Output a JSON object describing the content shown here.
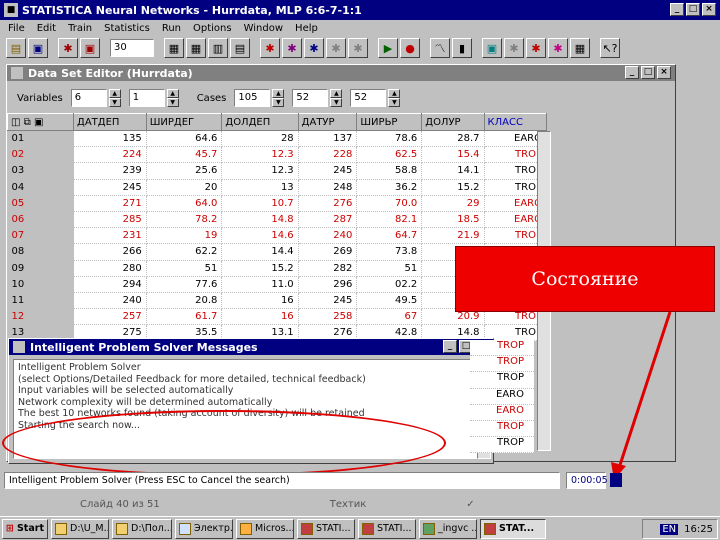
{
  "window": {
    "title": "STATISTICA Neural Networks - Hurrdata, MLP 6:6-7-1:1"
  },
  "menu": [
    "File",
    "Edit",
    "Train",
    "Statistics",
    "Run",
    "Options",
    "Window",
    "Help"
  ],
  "toolbar": {
    "epochs_value": "30"
  },
  "editor": {
    "title": "Data Set Editor (Hurrdata)",
    "variables_label": "Variables",
    "variables_value": "6",
    "variables_value2": "1",
    "cases_label": "Cases",
    "cases_value": "105",
    "cases_value2": "52",
    "cases_value3": "52",
    "columns": [
      "ДАТДЕП",
      "ШИРДЕГ",
      "ДОЛДЕП",
      "ДАТУР",
      "ШИРЬР",
      "ДОЛУР",
      "КЛАСС"
    ],
    "rows": [
      {
        "id": "01",
        "vals": [
          "135",
          "64.6",
          "28",
          "137",
          "78.6",
          "28.7"
        ],
        "cls": "EARO",
        "red": false
      },
      {
        "id": "02",
        "vals": [
          "224",
          "45.7",
          "12.3",
          "228",
          "62.5",
          "15.4"
        ],
        "cls": "TROP",
        "red": true
      },
      {
        "id": "03",
        "vals": [
          "239",
          "25.6",
          "12.3",
          "245",
          "58.8",
          "14.1"
        ],
        "cls": "TROP",
        "red": false
      },
      {
        "id": "04",
        "vals": [
          "245",
          "20",
          "13",
          "248",
          "36.2",
          "15.2"
        ],
        "cls": "TROP",
        "red": false
      },
      {
        "id": "05",
        "vals": [
          "271",
          "64.0",
          "10.7",
          "276",
          "70.0",
          "29"
        ],
        "cls": "EARO",
        "red": true
      },
      {
        "id": "06",
        "vals": [
          "285",
          "78.2",
          "14.8",
          "287",
          "82.1",
          "18.5"
        ],
        "cls": "EARO",
        "red": true
      },
      {
        "id": "07",
        "vals": [
          "231",
          "19",
          "14.6",
          "240",
          "64.7",
          "21.9"
        ],
        "cls": "TROP",
        "red": true
      },
      {
        "id": "08",
        "vals": [
          "266",
          "62.2",
          "14.4",
          "269",
          "73.8",
          "24."
        ],
        "cls": "",
        "red": false
      },
      {
        "id": "09",
        "vals": [
          "280",
          "51",
          "15.2",
          "282",
          "51",
          "17."
        ],
        "cls": "",
        "red": false
      },
      {
        "id": "10",
        "vals": [
          "294",
          "77.6",
          "11.0",
          "296",
          "02.2",
          "16."
        ],
        "cls": "",
        "red": false
      },
      {
        "id": "11",
        "vals": [
          "240",
          "20.8",
          "16",
          "245",
          "49.5",
          "14."
        ],
        "cls": "",
        "red": false
      },
      {
        "id": "12",
        "vals": [
          "257",
          "61.7",
          "16",
          "258",
          "67",
          "20.9"
        ],
        "cls": "TROP",
        "red": true
      },
      {
        "id": "13",
        "vals": [
          "275",
          "35.5",
          "13.1",
          "276",
          "42.8",
          "14.8"
        ],
        "cls": "TROP",
        "red": false
      }
    ],
    "extra_classes": [
      {
        "cls": "TROP",
        "red": true
      },
      {
        "cls": "TROP",
        "red": true
      },
      {
        "cls": "TROP",
        "red": false
      },
      {
        "cls": "EARO",
        "red": false
      },
      {
        "cls": "EARO",
        "red": true
      },
      {
        "cls": "TROP",
        "red": true
      },
      {
        "cls": "TROP",
        "red": false
      }
    ]
  },
  "messages": {
    "title": "Intelligent Problem Solver Messages",
    "lines": [
      "Intelligent Problem Solver",
      "(select Options/Detailed Feedback for more detailed, technical feedback)",
      "Input variables will be selected automatically",
      "Network complexity will be determined automatically",
      "The best 10 networks found (taking account of diversity) will be retained",
      "Starting the search now..."
    ]
  },
  "callout": {
    "text": "Состояние"
  },
  "status": {
    "message": "Intelligent Problem Solver (Press ESC to Cancel the search)",
    "time": "0:00:05"
  },
  "ppt": {
    "slide": "Слайд 40 из 51",
    "design": "Техтик"
  },
  "taskbar": {
    "start": "Start",
    "tasks": [
      "D:\\U_M...",
      "D:\\Пол...",
      "Электр...",
      "Micros...",
      "STATI...",
      "STATI...",
      "_ingvc ...",
      "STAT..."
    ],
    "clock": "16:25",
    "lang": "EN"
  }
}
